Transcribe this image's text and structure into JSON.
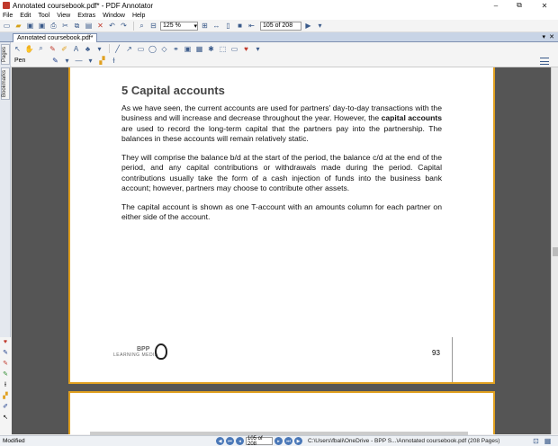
{
  "window": {
    "title": "Annotated coursebook.pdf* - PDF Annotator",
    "minimize": "–",
    "maximize": "⧉",
    "close": "✕"
  },
  "menu": [
    "File",
    "Edit",
    "Tool",
    "View",
    "Extras",
    "Window",
    "Help"
  ],
  "toolbar": {
    "zoom_value": "125 %",
    "page_value": "105 of 208"
  },
  "tab": {
    "label": "Annotated coursebook.pdf*",
    "close": "✕",
    "menu": "▾"
  },
  "sidebar": {
    "pages": "Pages",
    "bookmarks": "Bookmarks"
  },
  "toolbar3": {
    "pen_label": "Pen"
  },
  "document": {
    "heading": "5 Capital accounts",
    "p1_a": "As we have seen, the current accounts are used for partners' day-to-day transactions with the business and will increase and decrease throughout the year. However, the ",
    "p1_bold": "capital accounts",
    "p1_b": " are used to record the long-term capital that the partners pay into the partnership. The balances in these accounts will remain relatively static.",
    "p2": "They will comprise the balance b/d at the start of the period, the balance c/d at the end of the period, and any capital contributions or withdrawals made during the period. Capital contributions usually take the form of a cash injection of funds into the business bank account; however, partners may choose to contribute other assets.",
    "p3": "The capital account is shown as one T-account with an amounts column for each partner on either side of the account.",
    "logo": "BPP",
    "logo_sub": "LEARNING MEDIA",
    "page_number": "93"
  },
  "status": {
    "state": "Modified",
    "page_value": "105 of 208",
    "path": "C:\\Users\\fbali\\OneDrive - BPP S...\\Annotated coursebook.pdf (208 Pages)"
  },
  "colors": {
    "page_border": "#e0a020",
    "doc_background": "#555555",
    "tab_bar": "#c8d4e6"
  }
}
